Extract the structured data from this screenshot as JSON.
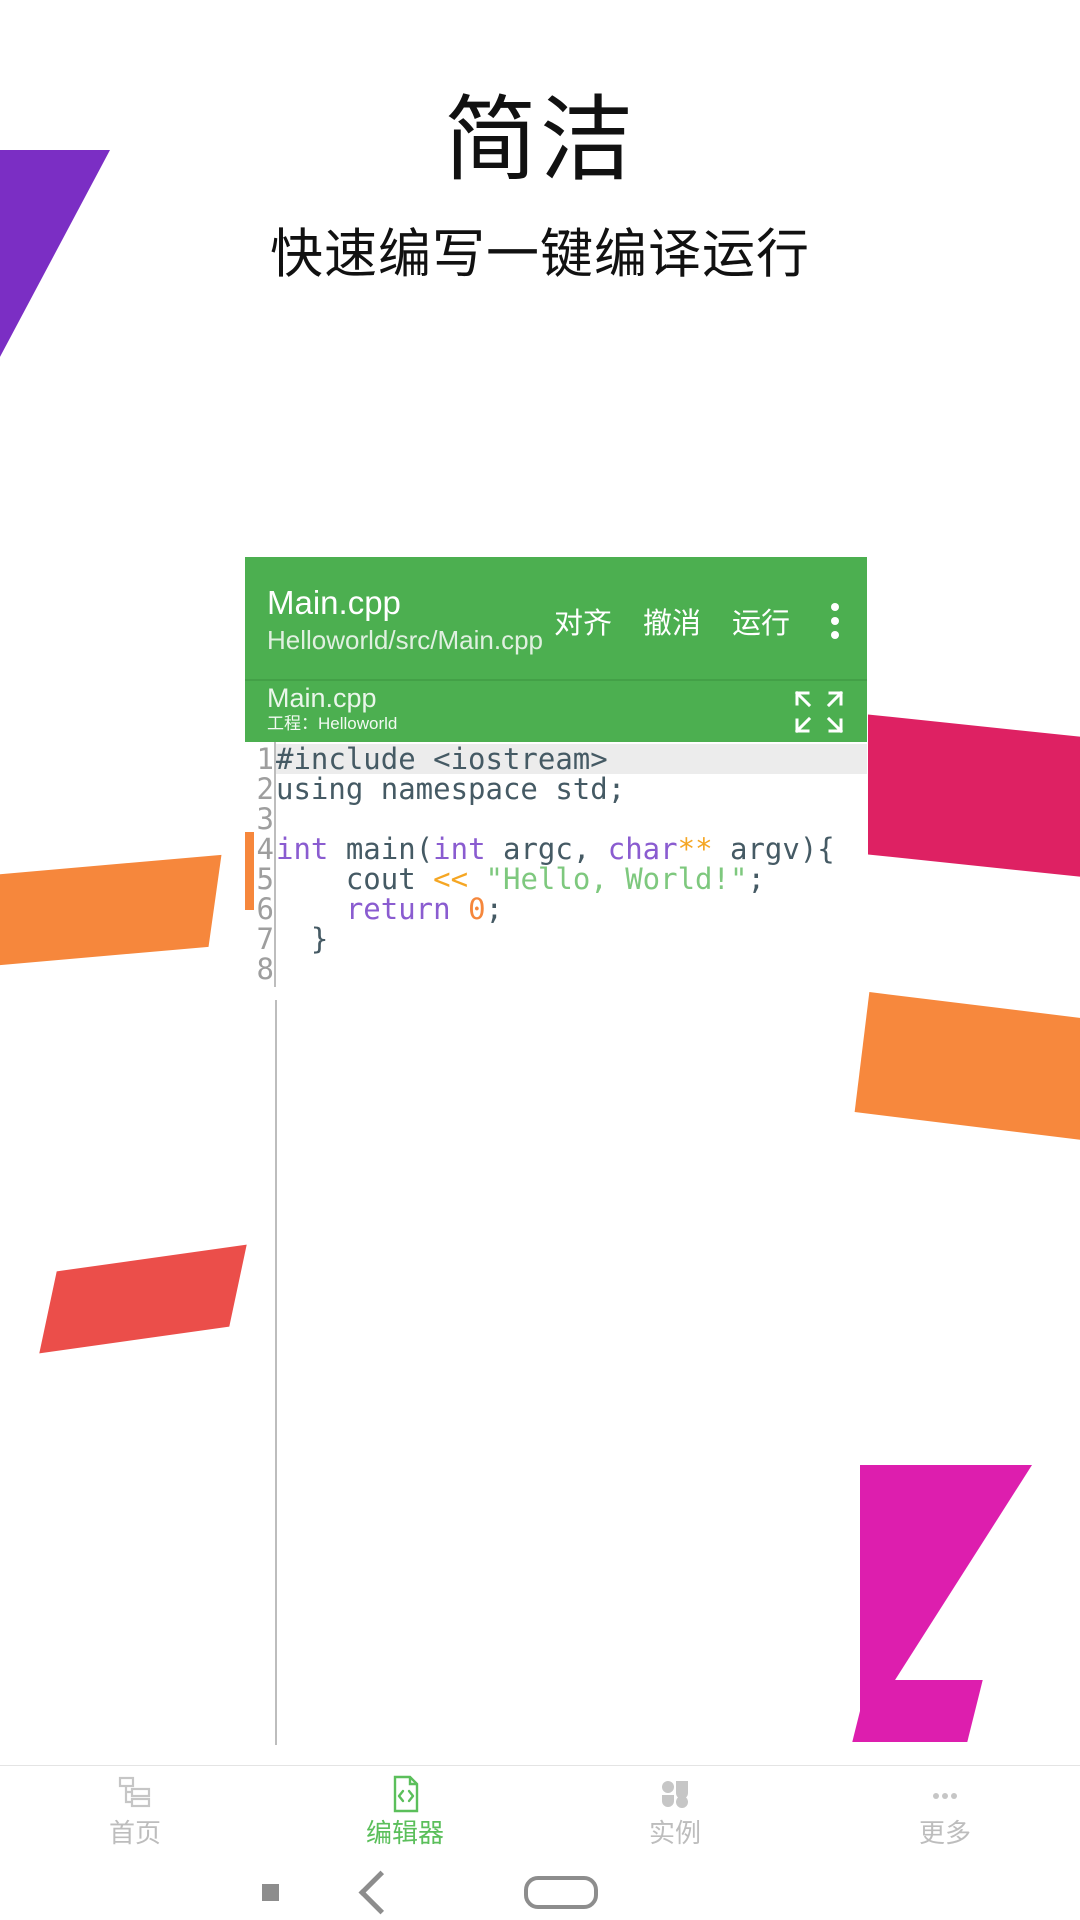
{
  "hero": {
    "title": "简洁",
    "subtitle": "快速编写一键编译运行"
  },
  "editor": {
    "appbar": {
      "filename": "Main.cpp",
      "filepath": "Helloworld/src/Main.cpp",
      "actions": [
        {
          "label": "对齐",
          "name": "align-button"
        },
        {
          "label": "撤消",
          "name": "undo-button"
        },
        {
          "label": "运行",
          "name": "run-button"
        }
      ],
      "overflow_icon": "more-vertical-icon"
    },
    "tab": {
      "name": "Main.cpp",
      "project": "工程：Helloworld",
      "expand_icon": "expand-fullscreen-icon"
    },
    "code": {
      "line_numbers": [
        "1",
        "2",
        "3",
        "4",
        "5",
        "6",
        "7",
        "8"
      ],
      "lines": [
        [
          {
            "t": "#include <iostream>",
            "c": "plain"
          }
        ],
        [
          {
            "t": "using namespace std;",
            "c": "plain"
          }
        ],
        [
          {
            "t": "",
            "c": "plain"
          }
        ],
        [
          {
            "t": "int",
            "c": "keyword"
          },
          {
            "t": " main(",
            "c": "plain"
          },
          {
            "t": "int",
            "c": "keyword"
          },
          {
            "t": " argc, ",
            "c": "plain"
          },
          {
            "t": "char",
            "c": "keyword"
          },
          {
            "t": "**",
            "c": "operator"
          },
          {
            "t": " argv){",
            "c": "plain"
          }
        ],
        [
          {
            "t": "    cout ",
            "c": "plain"
          },
          {
            "t": "<<",
            "c": "operator"
          },
          {
            "t": " ",
            "c": "plain"
          },
          {
            "t": "\"Hello, World!\"",
            "c": "string"
          },
          {
            "t": ";",
            "c": "plain"
          }
        ],
        [
          {
            "t": "    ",
            "c": "plain"
          },
          {
            "t": "return",
            "c": "keyword"
          },
          {
            "t": " ",
            "c": "plain"
          },
          {
            "t": "0",
            "c": "number"
          },
          {
            "t": ";",
            "c": "plain"
          }
        ],
        [
          {
            "t": "  }",
            "c": "plain"
          }
        ],
        [
          {
            "t": "",
            "c": "plain"
          }
        ]
      ],
      "active_line_index": 0
    }
  },
  "bottom_nav": {
    "items": [
      {
        "label": "首页",
        "icon": "project-tree-icon",
        "active": false
      },
      {
        "label": "编辑器",
        "icon": "code-file-icon",
        "active": true
      },
      {
        "label": "实例",
        "icon": "clover-grid-icon",
        "active": false
      },
      {
        "label": "更多",
        "icon": "more-horizontal-icon",
        "active": false
      }
    ]
  },
  "system_bar": {
    "recents_icon": "recents-square-icon",
    "back_icon": "back-chevron-icon",
    "home_icon": "home-pill-icon"
  },
  "colors": {
    "accent_green": "#4CAF50",
    "nav_active_green": "#5BBF5B",
    "tab_indicator_pink": "#E91E63",
    "deco_purple": "#7B2EC4",
    "deco_pink": "#DE2163",
    "deco_orange": "#F6873C",
    "deco_red": "#EB4E4A",
    "deco_magenta": "#DD1EAE",
    "code_keyword": "#8A5CD0",
    "code_operator": "#F5A623",
    "code_string": "#7EC87E",
    "code_number": "#F5873C",
    "code_plain": "#455A64"
  }
}
